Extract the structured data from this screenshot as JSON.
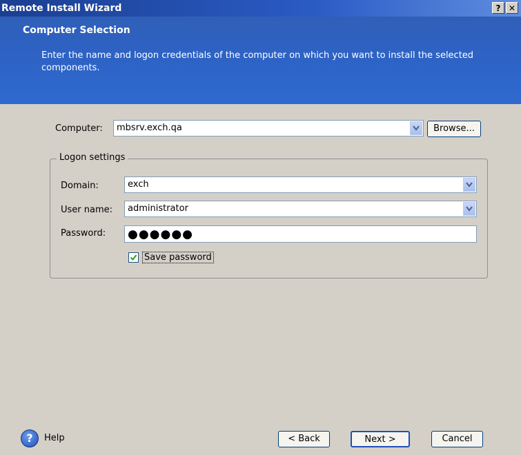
{
  "window": {
    "title": "Remote Install Wizard",
    "help_button": "?",
    "close_button": "✕"
  },
  "header": {
    "title": "Computer Selection",
    "description": "Enter the name and logon credentials of the computer on which you want to install the selected components."
  },
  "computer": {
    "label": "Computer:",
    "value": "mbsrv.exch.qa",
    "browse_label": "Browse..."
  },
  "logon": {
    "group_label": "Logon settings",
    "domain_label": "Domain:",
    "domain_value": "exch",
    "username_label": "User name:",
    "username_value": "administrator",
    "password_label": "Password:",
    "password_value": "●●●●●●",
    "save_password_label": "Save password",
    "save_password_checked": true
  },
  "footer": {
    "help_label": "Help",
    "back_label": "< Back",
    "next_label": "Next >",
    "cancel_label": "Cancel"
  },
  "colors": {
    "header_blue": "#2e63c6",
    "titlebar_blue": "#1b3f91",
    "dialog_bg": "#d4d0c8"
  }
}
